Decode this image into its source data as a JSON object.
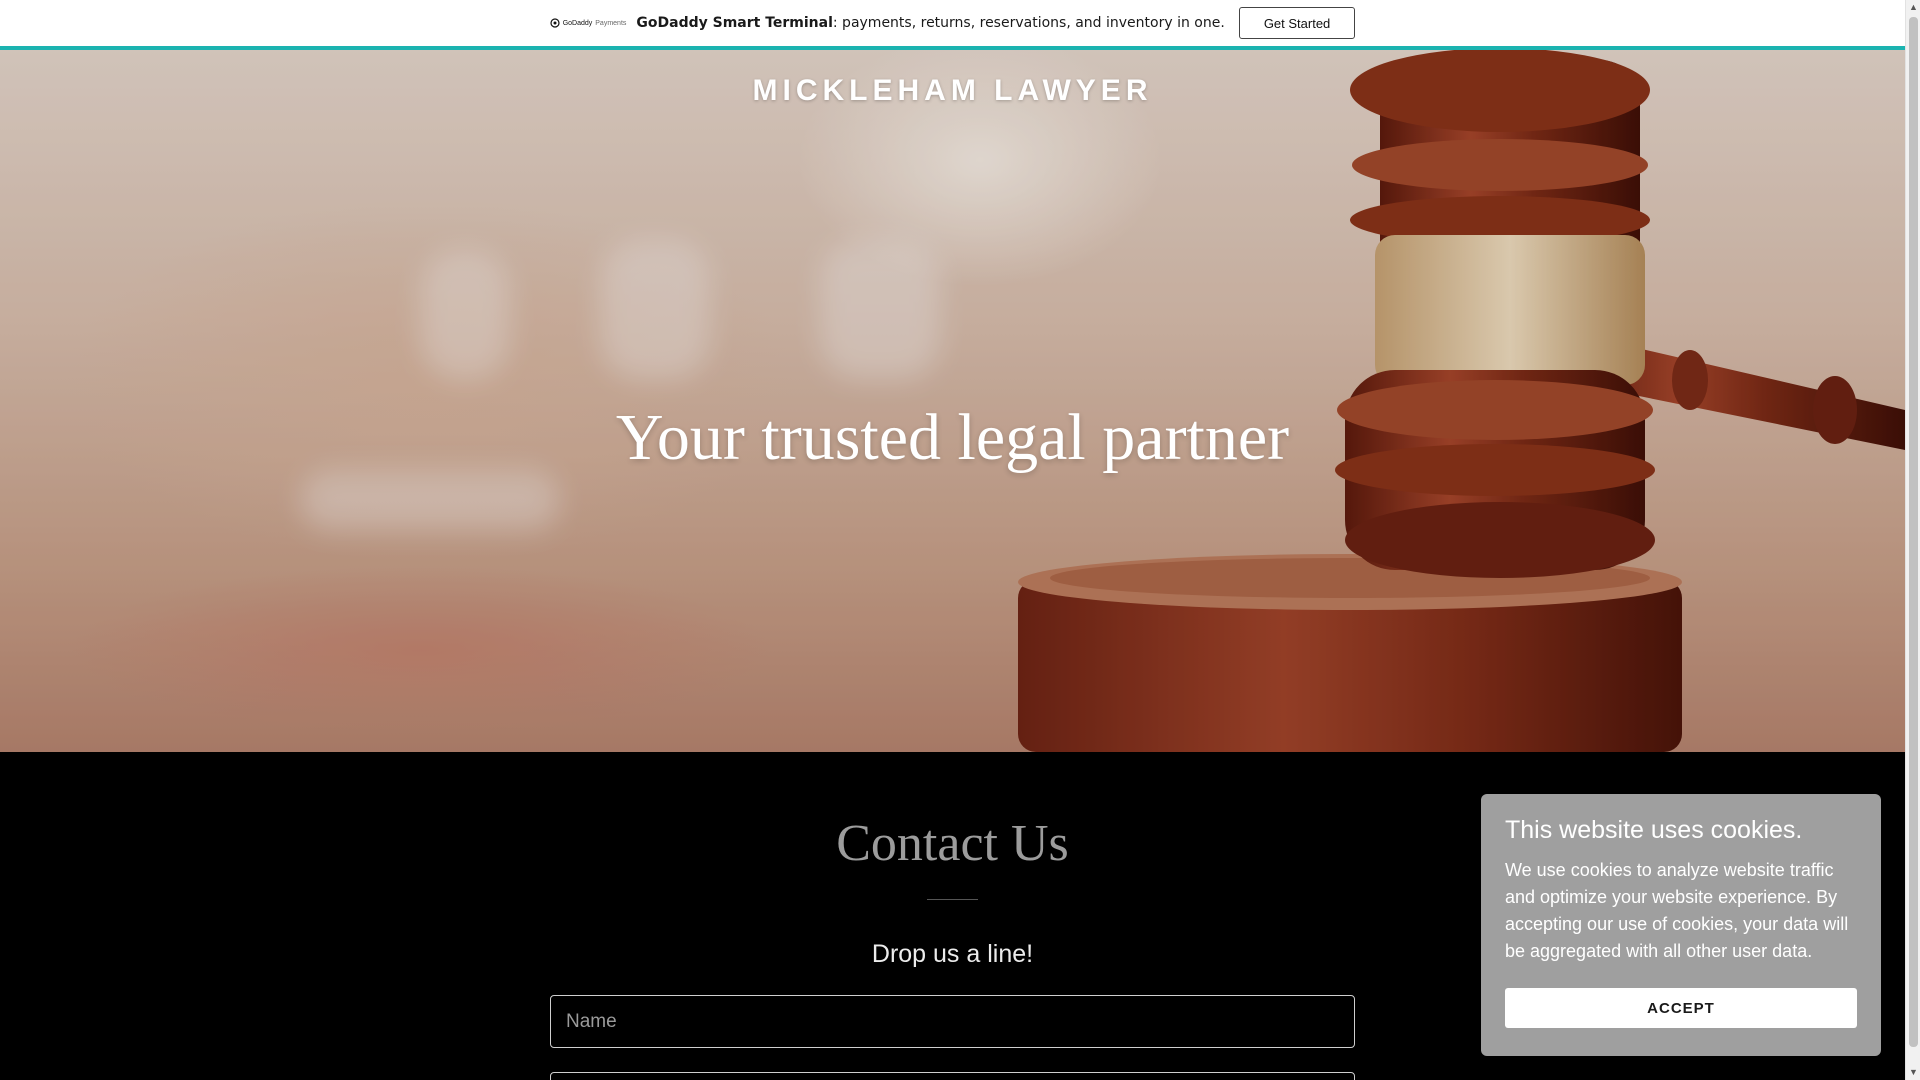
{
  "promo": {
    "logo_brand": "GoDaddy",
    "logo_suffix": "Payments",
    "headline_bold": "GoDaddy Smart Terminal",
    "headline_rest": ": payments, returns, reservations, and inventory in one.",
    "button_label": "Get Started",
    "accent_color": "#1bb3b0"
  },
  "hero": {
    "site_title": "MICKLEHAM LAWYER",
    "tagline": "Your trusted legal partner"
  },
  "contact": {
    "title": "Contact Us",
    "subtitle": "Drop us a line!",
    "name_placeholder": "Name"
  },
  "cookie_banner": {
    "title": "This website uses cookies.",
    "body": "We use cookies to analyze website traffic and optimize your website experience. By accepting our use of cookies, your data will be aggregated with all other user data.",
    "accept_label": "ACCEPT"
  },
  "scrollbar": {
    "up_icon": "arrow-up-icon",
    "down_icon": "arrow-down-icon"
  }
}
